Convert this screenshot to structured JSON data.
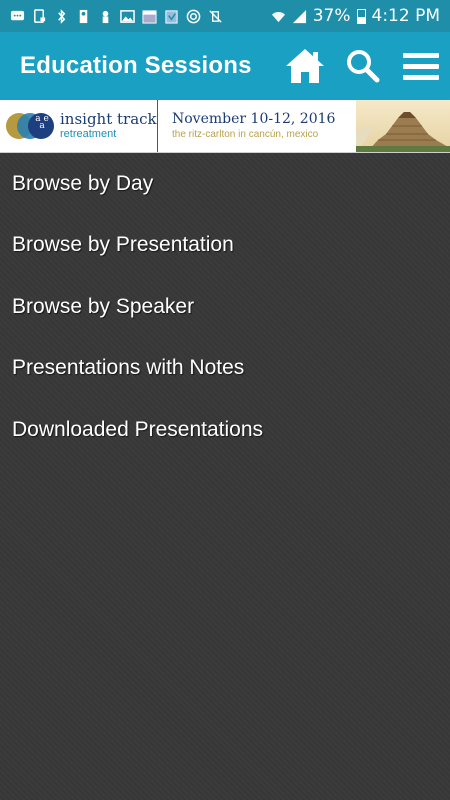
{
  "status_bar": {
    "battery": "37%",
    "time": "4:12 PM",
    "icons": [
      "chat-icon",
      "sim-icon",
      "bt-icon",
      "sd-icon",
      "person-icon",
      "image-icon",
      "calendar-icon",
      "clipboard-icon",
      "target-icon",
      "vibrate-off-icon",
      "wifi-icon",
      "signal-icon"
    ]
  },
  "app_bar": {
    "title": "Education Sessions",
    "actions": [
      "home-icon",
      "search-icon",
      "menu-icon"
    ]
  },
  "banner": {
    "logo_letters": "a e a",
    "logo_name": "insight track",
    "logo_sub": "retreatment",
    "event_date": "November 10-12, 2016",
    "event_place": "the ritz-carlton in cancún, mexico"
  },
  "menu": {
    "items": [
      "Browse by Day",
      "Browse by Presentation",
      "Browse by Speaker",
      "Presentations with Notes",
      "Downloaded Presentations"
    ]
  },
  "colors": {
    "status_bar": "#1f8fa9",
    "app_bar": "#1aa0c2",
    "background": "#3a3a3a"
  }
}
